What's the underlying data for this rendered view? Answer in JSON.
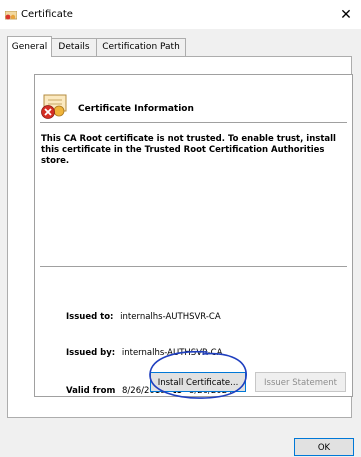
{
  "window": {
    "title": "Certificate",
    "close_glyph": "✕"
  },
  "tabs": [
    {
      "label": "General",
      "active": true
    },
    {
      "label": "Details",
      "active": false
    },
    {
      "label": "Certification Path",
      "active": false
    }
  ],
  "info": {
    "heading": "Certificate Information",
    "warning": "This CA Root certificate is not trusted. To enable trust, install this certificate in the Trusted Root Certification Authorities store.",
    "issued_to_label": "Issued to:",
    "issued_to_value": "internalhs-AUTHSVR-CA",
    "issued_by_label": "Issued by:",
    "issued_by_value": "internalhs-AUTHSVR-CA",
    "valid_from_label": "Valid from",
    "valid_from_value": "8/26/2019",
    "valid_to_label": "to",
    "valid_to_value": "8/26/2024"
  },
  "buttons": {
    "install": "Install Certificate...",
    "issuer": "Issuer Statement",
    "ok": "OK"
  },
  "colors": {
    "annotation": "#1f3fbf",
    "focus_border": "#0078d7"
  },
  "icons": {
    "title": "certificate-icon",
    "cert": "untrusted-certificate-icon"
  }
}
